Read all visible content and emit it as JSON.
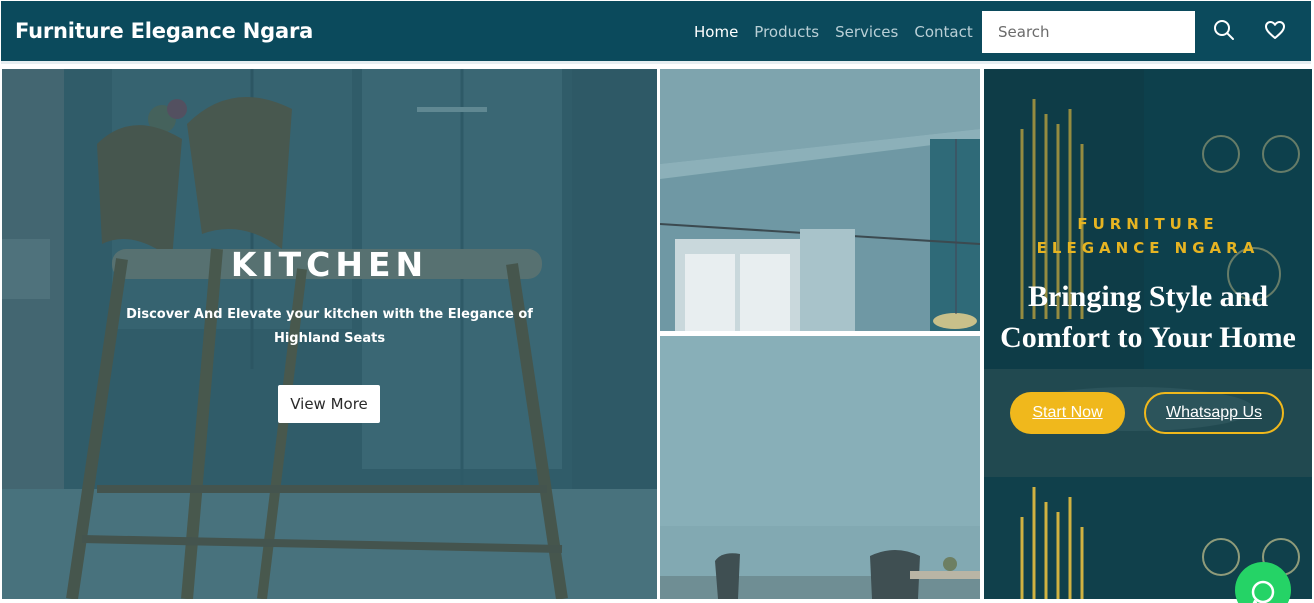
{
  "nav": {
    "brand": "Furniture Elegance Ngara",
    "links": [
      "Home",
      "Products",
      "Services",
      "Contact"
    ],
    "active_link": "Home",
    "search_placeholder": "Search",
    "icons": [
      "search-icon",
      "heart-icon"
    ]
  },
  "kitchen": {
    "title": "KITCHEN",
    "description": "Discover And Elevate your kitchen with the Elegance of Highland Seats",
    "button_label": "View More"
  },
  "hero": {
    "brand_line": "FURNITURE ELEGANCE NGARA",
    "title": "Bringing Style and Comfort to Your Home",
    "primary_button": "Start Now",
    "secondary_button": "Whatsapp Us"
  },
  "floating": {
    "icon": "whatsapp-icon"
  },
  "colors": {
    "nav_bg": "#0b4a5c",
    "accent": "#f0b81c",
    "whatsapp": "#25d366"
  }
}
